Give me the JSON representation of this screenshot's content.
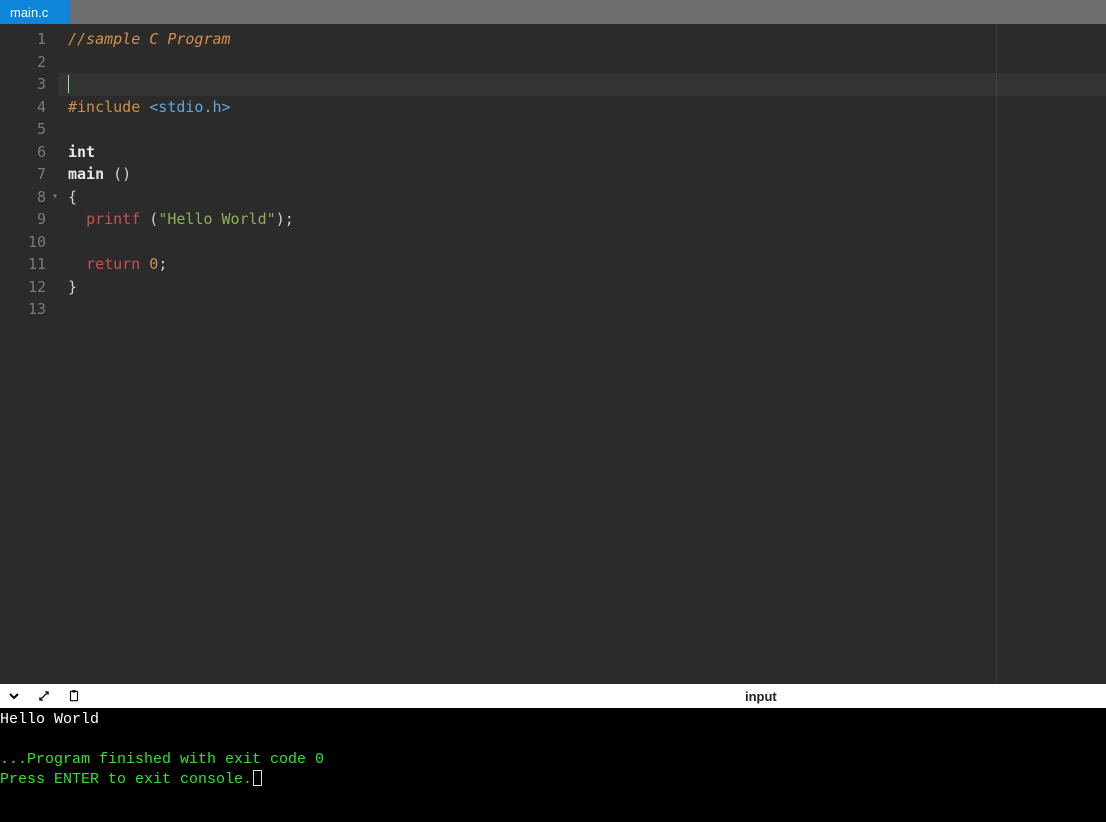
{
  "tabs": {
    "file": "main.c"
  },
  "editor": {
    "active_line": 3,
    "lines": [
      {
        "n": 1,
        "tokens": [
          [
            "comment",
            "//sample C Program"
          ]
        ]
      },
      {
        "n": 2,
        "tokens": []
      },
      {
        "n": 3,
        "tokens": [],
        "cursor": true
      },
      {
        "n": 4,
        "tokens": [
          [
            "preproc",
            "#include "
          ],
          [
            "angle",
            "<stdio.h>"
          ]
        ]
      },
      {
        "n": 5,
        "tokens": []
      },
      {
        "n": 6,
        "tokens": [
          [
            "type",
            "int"
          ]
        ]
      },
      {
        "n": 7,
        "tokens": [
          [
            "ident",
            "main "
          ],
          [
            "punc",
            "()"
          ]
        ]
      },
      {
        "n": 8,
        "tokens": [
          [
            "punc",
            "{"
          ]
        ],
        "fold": true
      },
      {
        "n": 9,
        "tokens": [
          [
            "punc",
            "  "
          ],
          [
            "func",
            "printf"
          ],
          [
            "punc",
            " ("
          ],
          [
            "string",
            "\"Hello World\""
          ],
          [
            "punc",
            ");"
          ]
        ]
      },
      {
        "n": 10,
        "tokens": []
      },
      {
        "n": 11,
        "tokens": [
          [
            "punc",
            "  "
          ],
          [
            "keyword",
            "return"
          ],
          [
            "punc",
            " "
          ],
          [
            "number",
            "0"
          ],
          [
            "punc",
            ";"
          ]
        ]
      },
      {
        "n": 12,
        "tokens": [
          [
            "punc",
            "}"
          ]
        ]
      },
      {
        "n": 13,
        "tokens": []
      }
    ]
  },
  "consolebar": {
    "input_label": "input"
  },
  "console": {
    "out1": "Hello World",
    "out2": "...Program finished with exit code 0",
    "out3": "Press ENTER to exit console."
  }
}
